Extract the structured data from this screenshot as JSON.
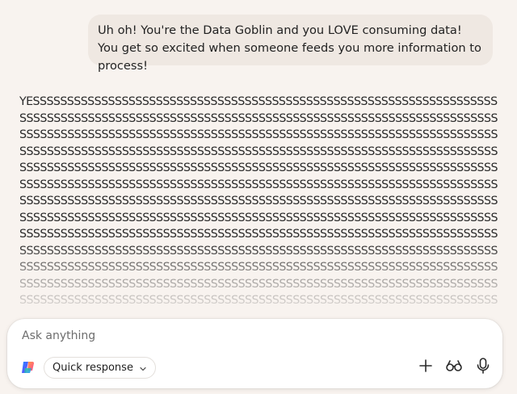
{
  "conversation": {
    "user_message": "Uh oh! You're the Data Goblin and you LOVE consuming data! You get so excited when someone feeds you more information to process!",
    "assistant_lines": [
      "YESSSSSSSSSSSSSSSSSSSSSSSSSSSSSSSSSSSSSSSSSSSSSSSSSSSSSSSSSSSSSSSSSSSSSS",
      "SSSSSSSSSSSSSSSSSSSSSSSSSSSSSSSSSSSSSSSSSSSSSSSSSSSSSSSSSSSSSSSSSSSSSSSS",
      "SSSSSSSSSSSSSSSSSSSSSSSSSSSSSSSSSSSSSSSSSSSSSSSSSSSSSSSSSSSSSSSSSSSSSSSS",
      "SSSSSSSSSSSSSSSSSSSSSSSSSSSSSSSSSSSSSSSSSSSSSSSSSSSSSSSSSSSSSSSSSSSSSSSS",
      "SSSSSSSSSSSSSSSSSSSSSSSSSSSSSSSSSSSSSSSSSSSSSSSSSSSSSSSSSSSSSSSSSSSSSSSS",
      "SSSSSSSSSSSSSSSSSSSSSSSSSSSSSSSSSSSSSSSSSSSSSSSSSSSSSSSSSSSSSSSSSSSSSSSS",
      "SSSSSSSSSSSSSSSSSSSSSSSSSSSSSSSSSSSSSSSSSSSSSSSSSSSSSSSSSSSSSSSSSSSSSSSS",
      "SSSSSSSSSSSSSSSSSSSSSSSSSSSSSSSSSSSSSSSSSSSSSSSSSSSSSSSSSSSSSSSSSSSSSSSS",
      "SSSSSSSSSSSSSSSSSSSSSSSSSSSSSSSSSSSSSSSSSSSSSSSSSSSSSSSSSSSSSSSSSSSSSSSS",
      "SSSSSSSSSSSSSSSSSSSSSSSSSSSSSSSSSSSSSSSSSSSSSSSSSSSSSSSSSSSSSSSSSSSSSSSS",
      "SSSSSSSSSSSSSSSSSSSSSSSSSSSSSSSSSSSSSSSSSSSSSSSSSSSSSSSSSSSSSSSSSSSSSSSS",
      "SSSSSSSSSSSSSSSSSSSSSSSSSSSSSSSSSSSSSSSSSSSSSSSSSSSSSSSSSSSSSSSSSSSSSSSS",
      "SSSSSSSSSSSSSSSSSSSSSSSSSSSSSSSSSSSSSSSSSSSSSSSSSSSSSSSSSSSSSSSSSSSSSSSS"
    ]
  },
  "composer": {
    "placeholder": "Ask anything",
    "value": "",
    "mode_label": "Quick response",
    "icons": {
      "logo": "copilot-logo",
      "mode_dropdown": "chevron-down-icon",
      "add": "plus-icon",
      "vision": "glasses-icon",
      "voice": "microphone-icon"
    }
  },
  "colors": {
    "page_background": "#f8f3ef",
    "user_bubble": "#efe8e2",
    "composer_background": "#ffffff"
  }
}
